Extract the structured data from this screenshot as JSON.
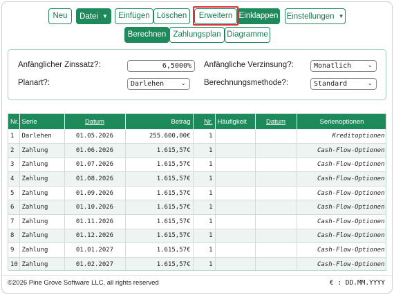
{
  "colors": {
    "accent": "#1e8a5c",
    "highlight": "#e0303a",
    "row_alt": "#eef4f1"
  },
  "toolbar": {
    "new_label": "Neu",
    "file_label": "Datei",
    "insert_label": "Einfügen",
    "delete_label": "Löschen",
    "expand_label": "Erweitern",
    "collapse_label": "Einklappen",
    "settings_label": "Einstellungen"
  },
  "tabs": {
    "calculate": "Berechnen",
    "schedule": "Zahlungsplan",
    "charts": "Diagramme"
  },
  "settings": {
    "interest_rate_label": "Anfänglicher Zinssatz?:",
    "interest_rate_value": "6,5000%",
    "compounding_label": "Anfängliche Verzinsung?:",
    "compounding_value": "Monatlich",
    "plan_type_label": "Planart?:",
    "plan_type_value": "Darlehen",
    "method_label": "Berechnungsmethode?:",
    "method_value": "Standard"
  },
  "table": {
    "headers": {
      "nr": "Nr.",
      "series": "Serie",
      "date": "Datum",
      "amount": "Betrag",
      "count": "Nr.",
      "frequency": "Häufigkeit",
      "date2": "Datum",
      "options": "Serienoptionen"
    },
    "rows": [
      {
        "nr": "1",
        "series": "Darlehen",
        "date": "01.05.2026",
        "amount": "255.600,00€",
        "count": "1",
        "options": "Kreditoptionen"
      },
      {
        "nr": "2",
        "series": "Zahlung",
        "date": "01.06.2026",
        "amount": "1.615,57€",
        "count": "1",
        "options": "Cash-Flow-Optionen"
      },
      {
        "nr": "3",
        "series": "Zahlung",
        "date": "01.07.2026",
        "amount": "1.615,57€",
        "count": "1",
        "options": "Cash-Flow-Optionen"
      },
      {
        "nr": "4",
        "series": "Zahlung",
        "date": "01.08.2026",
        "amount": "1.615,57€",
        "count": "1",
        "options": "Cash-Flow-Optionen"
      },
      {
        "nr": "5",
        "series": "Zahlung",
        "date": "01.09.2026",
        "amount": "1.615,57€",
        "count": "1",
        "options": "Cash-Flow-Optionen"
      },
      {
        "nr": "6",
        "series": "Zahlung",
        "date": "01.10.2026",
        "amount": "1.615,57€",
        "count": "1",
        "options": "Cash-Flow-Optionen"
      },
      {
        "nr": "7",
        "series": "Zahlung",
        "date": "01.11.2026",
        "amount": "1.615,57€",
        "count": "1",
        "options": "Cash-Flow-Optionen"
      },
      {
        "nr": "8",
        "series": "Zahlung",
        "date": "01.12.2026",
        "amount": "1.615,57€",
        "count": "1",
        "options": "Cash-Flow-Optionen"
      },
      {
        "nr": "9",
        "series": "Zahlung",
        "date": "01.01.2027",
        "amount": "1.615,57€",
        "count": "1",
        "options": "Cash-Flow-Optionen"
      },
      {
        "nr": "10",
        "series": "Zahlung",
        "date": "01.02.2027",
        "amount": "1.615,57€",
        "count": "1",
        "options": "Cash-Flow-Optionen"
      }
    ]
  },
  "footer": {
    "copyright": "©2026 Pine Grove Software LLC, all rights reserved",
    "locale": "€ : DD.MM.YYYY"
  }
}
